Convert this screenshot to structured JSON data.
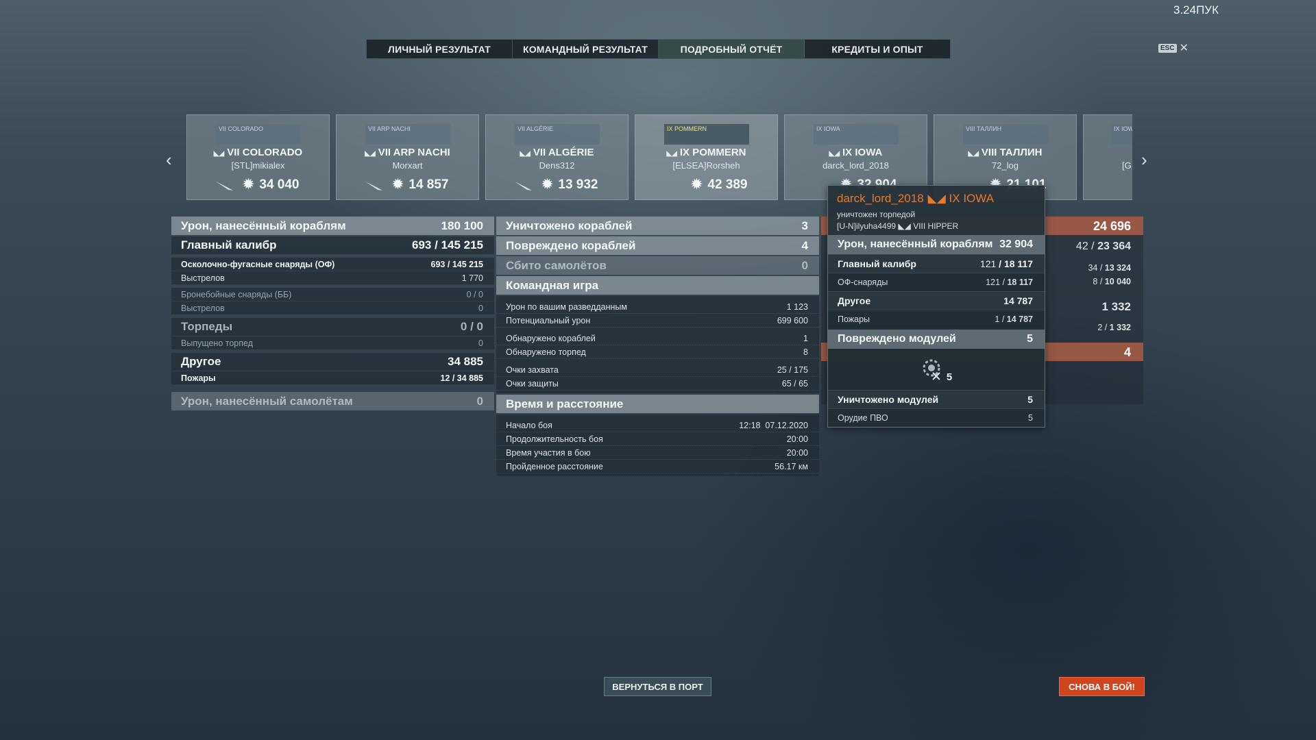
{
  "hud": {
    "fps": "3.24ПУК",
    "esc_key": "ESC",
    "close": "✕"
  },
  "tabs": [
    {
      "label": "ЛИЧНЫЙ РЕЗУЛЬТАТ"
    },
    {
      "label": "КОМАНДНЫЙ РЕЗУЛЬТАТ"
    },
    {
      "label": "ПОДРОБНЫЙ ОТЧЁТ",
      "active": true
    },
    {
      "label": "КРЕДИТЫ И ОПЫТ"
    }
  ],
  "cards": [
    {
      "thumb": "VII COLORADO",
      "ship": "VII COLORADO",
      "player": "[STL]mikialex",
      "damage": "34 040"
    },
    {
      "thumb": "VII ARP NACHI",
      "ship": "VII ARP NACHI",
      "player": "Morxart",
      "damage": "14 857"
    },
    {
      "thumb": "VII ALGÉRIE",
      "ship": "VII ALGÉRIE",
      "player": "Dens312",
      "damage": "13 932"
    },
    {
      "thumb": "IX POMMERN",
      "ship": "IX POMMERN",
      "player": "[ELSEA]Rorsheh",
      "damage": "42 389"
    },
    {
      "thumb": "IX IOWA",
      "ship": "IX IOWA",
      "player": "darck_lord_2018",
      "damage": "32 904"
    },
    {
      "thumb": "VIII ТАЛЛИН",
      "ship": "VIII ТАЛЛИН",
      "player": "72_log",
      "damage": "21 101"
    },
    {
      "thumb": "IX IOWA",
      "ship": "",
      "player": "[G",
      "damage": ""
    }
  ],
  "left": {
    "damage_ships": {
      "label": "Урон, нанесённый кораблям",
      "value": "180 100"
    },
    "main_battery": {
      "label": "Главный калибр",
      "hits": "693",
      "total": "145 215"
    },
    "he": {
      "label": "Осколочно-фугасные снаряды (ОФ)",
      "hits": "693",
      "total": "145 215"
    },
    "he_shots": {
      "label": "Выстрелов",
      "value": "1 770"
    },
    "ap": {
      "label": "Бронебойные снаряды (ББ)",
      "value": "0 / 0"
    },
    "ap_shots": {
      "label": "Выстрелов",
      "value": "0"
    },
    "torpedoes": {
      "label": "Торпеды",
      "value": "0 / 0"
    },
    "torps_launched": {
      "label": "Выпущено торпед",
      "value": "0"
    },
    "other": {
      "label": "Другое",
      "value": "34 885"
    },
    "fires": {
      "label": "Пожары",
      "hits": "12",
      "total": "34 885"
    },
    "damage_planes": {
      "label": "Урон, нанесённый самолётам",
      "value": "0"
    }
  },
  "middle": {
    "destroyed": {
      "label": "Уничтожено кораблей",
      "value": "3"
    },
    "damaged": {
      "label": "Повреждено кораблей",
      "value": "4"
    },
    "planes": {
      "label": "Сбито самолётов",
      "value": "0"
    },
    "team_play": "Командная игра",
    "team_rows": [
      {
        "label": "Урон по вашим разведданным",
        "value": "1 123"
      },
      {
        "label": "Потенциальный урон",
        "value": "699 600"
      },
      {
        "label": "Обнаружено кораблей",
        "value": "1"
      },
      {
        "label": "Обнаружено торпед",
        "value": "8"
      },
      {
        "label": "Очки захвата",
        "value": "25 / 175"
      },
      {
        "label": "Очки защиты",
        "value": "65 / 65"
      }
    ],
    "time_distance": "Время и расстояние",
    "time_rows": [
      {
        "label": "Начало боя",
        "value": "12:18  07.12.2020"
      },
      {
        "label": "Продолжительность боя",
        "value": "20:00"
      },
      {
        "label": "Время участия в бою",
        "value": "20:00"
      },
      {
        "label": "Пройденное расстояние",
        "value": "56.17 км"
      }
    ]
  },
  "right": {
    "bar1": "24 696",
    "r1_hits": "42",
    "r1_total": "23 364",
    "r2_hits": "34",
    "r2_total": "13 324",
    "r3_hits": "8",
    "r3_total": "10 040",
    "r4": "1 332",
    "r5_hits": "2",
    "r5_total": "1 332",
    "bar2": "4"
  },
  "tooltip": {
    "player": "darck_lord_2018",
    "ship": "IX IOWA",
    "status": "уничтожен торпедой",
    "killer": "[U-N]ilyuha4499",
    "killer_ship": "VIII HIPPER",
    "damage": {
      "label": "Урон, нанесённый кораблям",
      "value": "32 904"
    },
    "main": {
      "label": "Главный калибр",
      "hits": "121",
      "total": "18 117"
    },
    "he": {
      "label": "ОФ-снаряды",
      "hits": "121",
      "total": "18 117"
    },
    "other": {
      "label": "Другое",
      "value": "14 787"
    },
    "fires": {
      "label": "Пожары",
      "hits": "1",
      "total": "14 787"
    },
    "modules_damaged": {
      "label": "Повреждено модулей",
      "value": "5"
    },
    "module_count": "5",
    "modules_destroyed": {
      "label": "Уничтожено модулей",
      "value": "5"
    },
    "aa": {
      "label": "Орудие ПВО",
      "value": "5"
    }
  },
  "buttons": {
    "port": "ВЕРНУТЬСЯ В ПОРТ",
    "battle": "СНОВА В БОЙ!"
  },
  "colors": {
    "accent_orange": "#e8782c",
    "battle_button": "#d2431f",
    "active_tab": "#384e4e"
  }
}
